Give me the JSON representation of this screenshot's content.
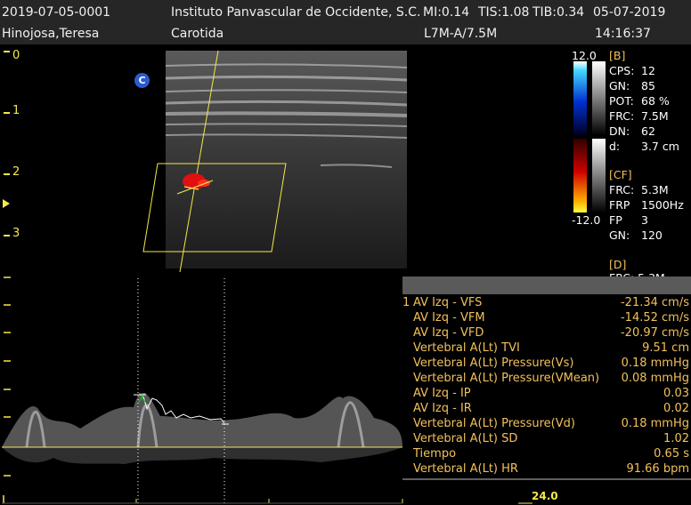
{
  "header": {
    "patient_id": "2019-07-05-0001",
    "patient_name": "Hinojosa,Teresa",
    "institution": "Instituto Panvascular de Occidente, S.C.",
    "mi": "MI:0.14",
    "tis": "TIS:1.08",
    "tib": "TIB:0.34",
    "date": "05-07-2019",
    "exam": "Carotida",
    "probe": "L7M-A/7.5M",
    "time": "14:16:37"
  },
  "depth_scale": {
    "labels": [
      "0",
      "1",
      "2",
      "3"
    ]
  },
  "orientation_marker": "C",
  "color_scale": {
    "max": "12.0",
    "min": "-12.0"
  },
  "b_mode": {
    "title": "[B]",
    "params": [
      {
        "key": "CPS:",
        "value": "12"
      },
      {
        "key": "GN:",
        "value": "85"
      },
      {
        "key": "POT:",
        "value": "68 %"
      },
      {
        "key": "FRC:",
        "value": "7.5M"
      },
      {
        "key": "DN:",
        "value": "62"
      },
      {
        "key": "d:",
        "value": "3.7 cm"
      }
    ]
  },
  "cf_mode": {
    "title": "[CF]",
    "params": [
      {
        "key": "FRC:",
        "value": "5.3M"
      },
      {
        "key": "FRP",
        "value": "1500Hz"
      },
      {
        "key": "FP",
        "value": "3"
      },
      {
        "key": "GN:",
        "value": "120"
      }
    ]
  },
  "d_mode": {
    "title": "[D]",
    "partial": "FRC: 5.3M"
  },
  "measurements": {
    "index": "1",
    "rows": [
      {
        "label": "AV Izq - VFS",
        "value": "-21.34 cm/s"
      },
      {
        "label": "AV Izq - VFM",
        "value": "-14.52 cm/s"
      },
      {
        "label": "AV Izq - VFD",
        "value": "-20.97 cm/s"
      },
      {
        "label": "Vertebral A(Lt) TVI",
        "value": "9.51 cm"
      },
      {
        "label": "Vertebral A(Lt) Pressure(Vs)",
        "value": "0.18 mmHg"
      },
      {
        "label": "Vertebral A(Lt) Pressure(VMean)",
        "value": "0.08 mmHg"
      },
      {
        "label": "AV Izq - IP",
        "value": "0.03"
      },
      {
        "label": "AV Izq - IR",
        "value": "0.02"
      },
      {
        "label": "Vertebral A(Lt) Pressure(Vd)",
        "value": "0.18 mmHg"
      },
      {
        "label": "Vertebral A(Lt) SD",
        "value": "1.02"
      },
      {
        "label": "Tiempo",
        "value": "0.65 s"
      },
      {
        "label": "Vertebral A(Lt) HR",
        "value": "91.66 bpm"
      }
    ]
  },
  "sweep_label": "24.0",
  "colors": {
    "yellow": "#f5e84a",
    "orange": "#f2c05a",
    "header_bg": "#262626",
    "gray_bar": "#5a5a5a"
  }
}
